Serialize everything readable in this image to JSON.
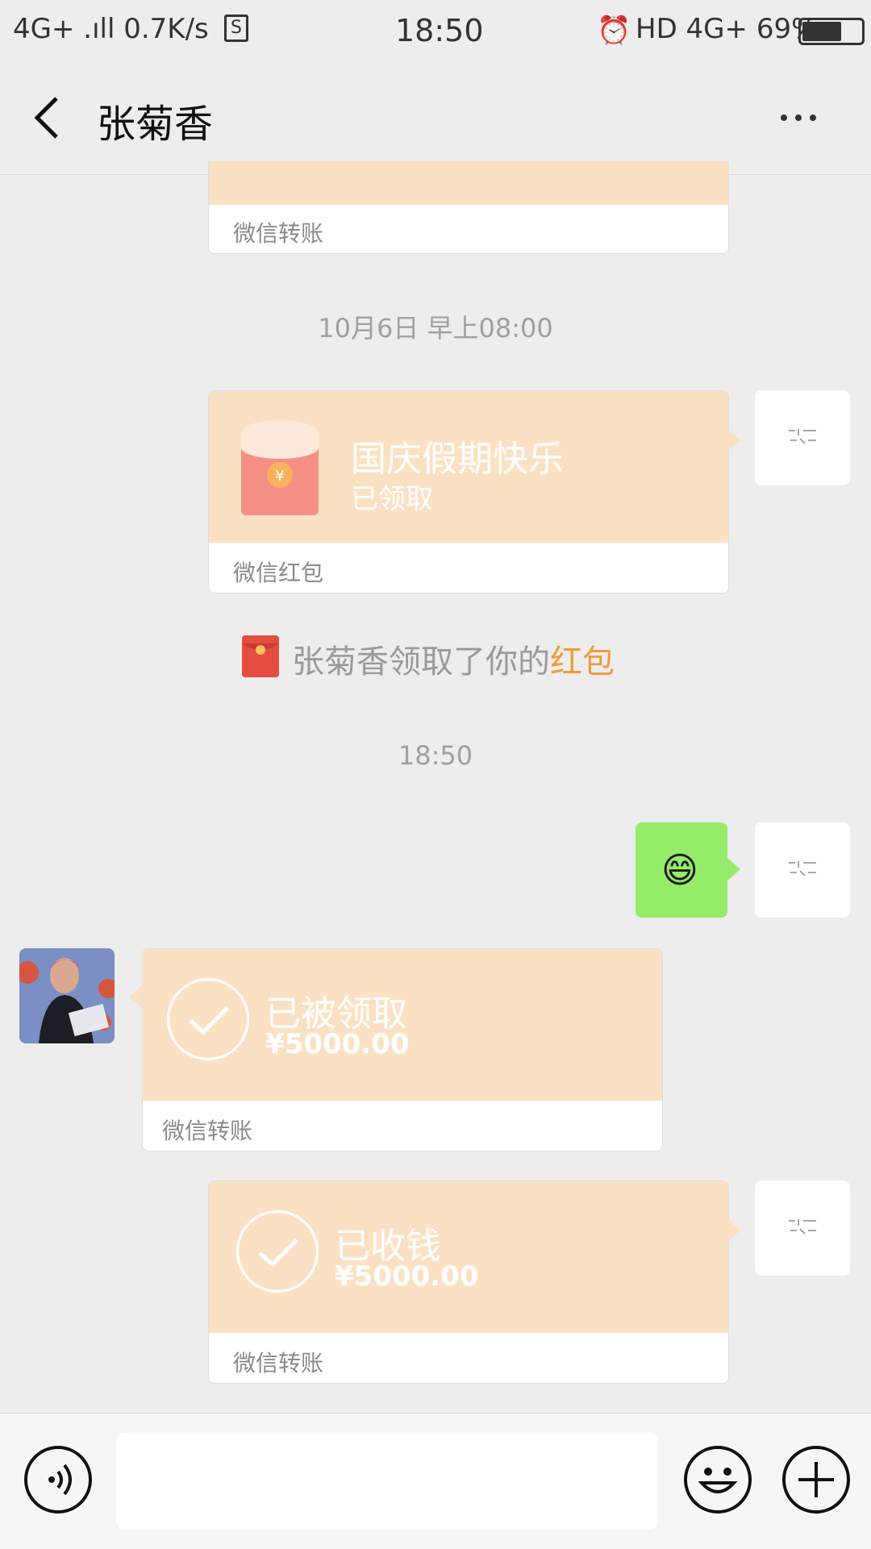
{
  "status_bar": {
    "left": "4G+ .ıll 0.7K/s",
    "time": "18:50",
    "right": "HD 4G+ 69%"
  },
  "header": {
    "title": "张菊香"
  },
  "messages": {
    "transfer_top_footer": "微信转账",
    "timestamp_1": "10月6日 早上08:00",
    "red_packet": {
      "title": "国庆假期快乐",
      "status": "已领取",
      "footer": "微信红包"
    },
    "system_notice": {
      "text": "张菊香领取了你的",
      "link": "红包"
    },
    "timestamp_2": "18:50",
    "emoji": "😄",
    "transfer_received_by_her": {
      "title": "已被领取",
      "amount": "¥5000.00",
      "footer": "微信转账"
    },
    "transfer_received_by_me": {
      "title": "已收钱",
      "amount": "¥5000.00",
      "footer": "微信转账"
    }
  },
  "colors": {
    "card_top": "#fbe1c4",
    "link_orange": "#f29a38",
    "green_bubble": "#95ec69"
  }
}
